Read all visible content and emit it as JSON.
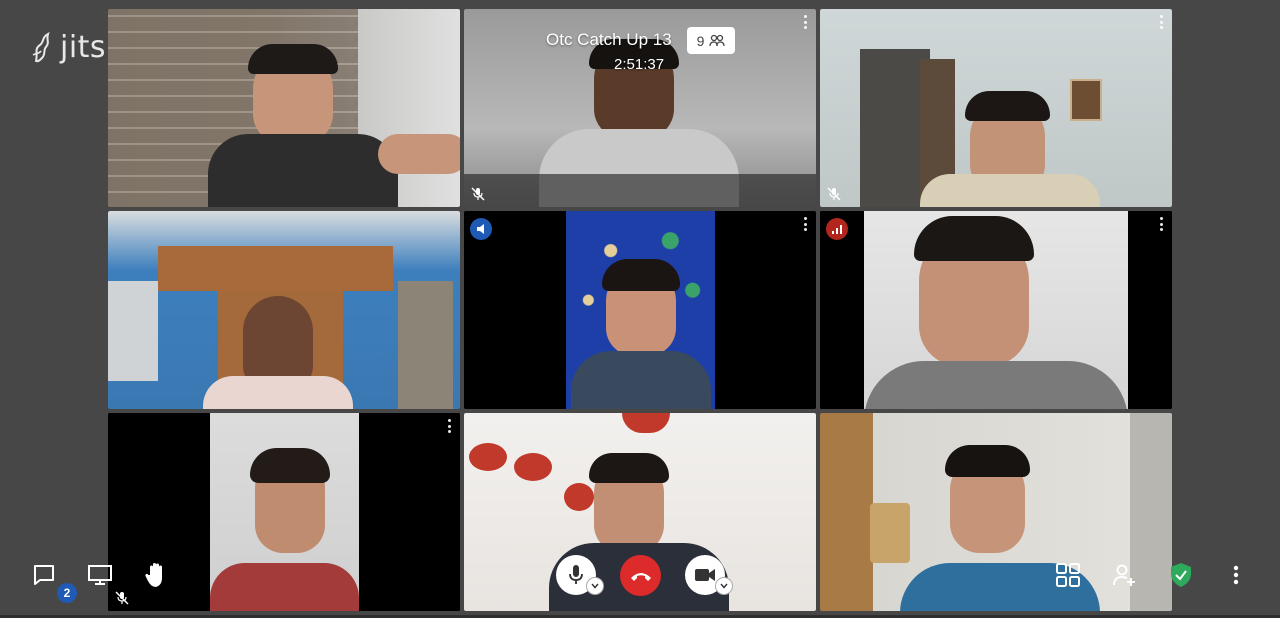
{
  "app": {
    "logo_text": "jitsi"
  },
  "header": {
    "conference_title": "Otc Catch Up 13",
    "participant_count": "9",
    "elapsed_time": "2:51:37"
  },
  "toolbar": {
    "chat_unread_count": "2"
  },
  "colors": {
    "accent_blue": "#1f5ab4",
    "hangup_red": "#dd2a2a",
    "security_green": "#2eaa5d",
    "background": "#474747"
  },
  "tiles": [
    {
      "id": "t1",
      "muted": false,
      "menu": false,
      "active": false,
      "badge": null
    },
    {
      "id": "t2",
      "muted": true,
      "menu": true,
      "active": false,
      "badge": null
    },
    {
      "id": "t3",
      "muted": true,
      "menu": true,
      "active": false,
      "badge": null
    },
    {
      "id": "t4",
      "muted": false,
      "menu": false,
      "active": false,
      "badge": null
    },
    {
      "id": "t5",
      "muted": false,
      "menu": true,
      "active": true,
      "badge": "dominant-speaker-icon"
    },
    {
      "id": "t6",
      "muted": false,
      "menu": true,
      "active": false,
      "badge": "connection-status-icon"
    },
    {
      "id": "t7",
      "muted": true,
      "menu": true,
      "active": false,
      "badge": null
    },
    {
      "id": "t8",
      "muted": false,
      "menu": false,
      "active": false,
      "badge": null
    },
    {
      "id": "t9",
      "muted": false,
      "menu": false,
      "active": false,
      "badge": null
    }
  ]
}
